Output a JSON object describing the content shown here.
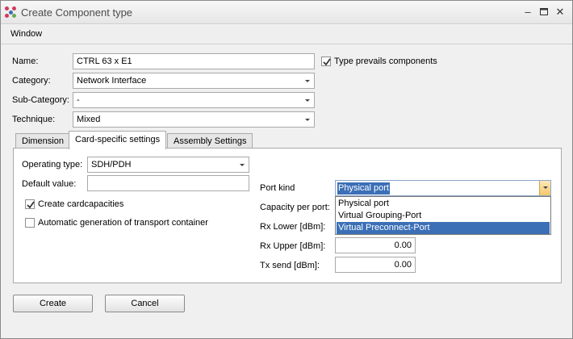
{
  "window": {
    "title": "Create Component type"
  },
  "menu": {
    "window_label": "Window"
  },
  "form": {
    "name_label": "Name:",
    "name_value": "CTRL 63 x E1",
    "type_prevails_label": "Type prevails components",
    "type_prevails_checked": true,
    "category_label": "Category:",
    "category_value": "Network Interface",
    "subcategory_label": "Sub-Category:",
    "subcategory_value": "-",
    "technique_label": "Technique:",
    "technique_value": "Mixed"
  },
  "tabs": [
    {
      "label": "Dimension",
      "active": false
    },
    {
      "label": "Card-specific settings",
      "active": true
    },
    {
      "label": "Assembly Settings",
      "active": false
    }
  ],
  "card": {
    "operating_type_label": "Operating type:",
    "operating_type_value": "SDH/PDH",
    "default_value_label": "Default value:",
    "default_value_value": "",
    "create_cardcapacities_label": "Create cardcapacities",
    "create_cardcapacities_checked": true,
    "auto_transport_label": "Automatic generation of transport container",
    "auto_transport_checked": false,
    "port_kind_label": "Port kind",
    "port_kind_value": "Physical port",
    "port_kind_options": [
      "Physical port",
      "Virtual Grouping-Port",
      "Virtual Preconnect-Port"
    ],
    "port_kind_highlighted": "Virtual Preconnect-Port",
    "capacity_label": "Capacity per port:",
    "rx_lower_label": "Rx Lower [dBm]:",
    "rx_upper_label": "Rx Upper [dBm]:",
    "rx_upper_value": "0.00",
    "tx_send_label": "Tx send [dBm]:",
    "tx_send_value": "0.00"
  },
  "buttons": {
    "create_label": "Create",
    "cancel_label": "Cancel"
  },
  "colors": {
    "selection": "#3b6fb6",
    "accent_icon": [
      "#d23a5a",
      "#3b6fb6",
      "#6aa84f"
    ]
  }
}
